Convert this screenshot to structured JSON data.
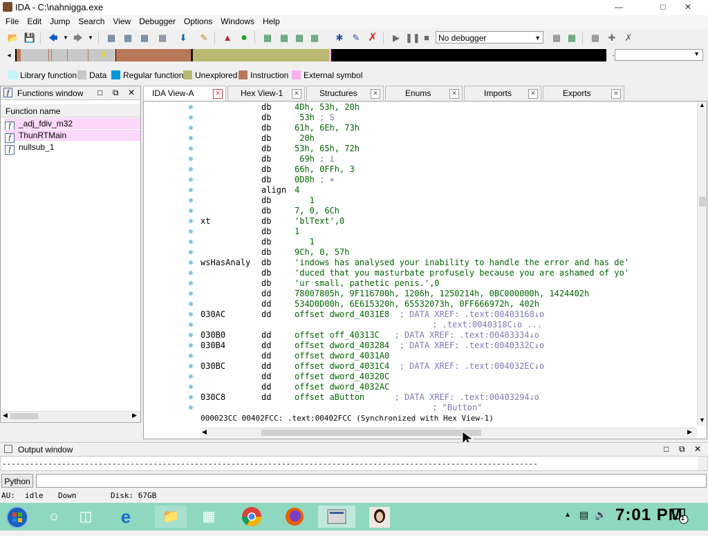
{
  "window": {
    "title": "IDA - C:\\nahnigga.exe"
  },
  "menu": [
    "File",
    "Edit",
    "Jump",
    "Search",
    "View",
    "Debugger",
    "Options",
    "Windows",
    "Help"
  ],
  "toolbar": {
    "debugger_select": "No debugger"
  },
  "legend": [
    {
      "label": "Library function",
      "color": "#c0f4f8"
    },
    {
      "label": "Data",
      "color": "#c8c8c8"
    },
    {
      "label": "Regular function",
      "color": "#0098d8"
    },
    {
      "label": "Unexplored",
      "color": "#b8b870"
    },
    {
      "label": "Instruction",
      "color": "#b87858"
    },
    {
      "label": "External symbol",
      "color": "#f8b0f0"
    }
  ],
  "functions_window": {
    "title": "Functions window",
    "column": "Function name",
    "items": [
      "_adj_fdiv_m32",
      "ThunRTMain",
      "nullsub_1"
    ]
  },
  "tabs": [
    "IDA View-A",
    "Hex View-1",
    "Structures",
    "Enums",
    "Imports",
    "Exports"
  ],
  "disasm": [
    {
      "label": "",
      "mn": "db",
      "ops": "4Dh, 53h, 20h",
      "cmt": ""
    },
    {
      "label": "",
      "mn": "db",
      "ops": " 53h",
      "cmt": "; S"
    },
    {
      "label": "",
      "mn": "db",
      "ops": "61h, 6Eh, 73h",
      "cmt": ""
    },
    {
      "label": "",
      "mn": "db",
      "ops": " 20h",
      "cmt": ""
    },
    {
      "label": "",
      "mn": "db",
      "ops": "53h, 65h, 72h",
      "cmt": ""
    },
    {
      "label": "",
      "mn": "db",
      "ops": " 69h",
      "cmt": "; i"
    },
    {
      "label": "",
      "mn": "db",
      "ops": "66h, 0FFh, 3",
      "cmt": ""
    },
    {
      "label": "",
      "mn": "db",
      "ops": "0D8h",
      "cmt": "; +"
    },
    {
      "label": "",
      "mn": "align",
      "ops": "4",
      "cmt": ""
    },
    {
      "label": "",
      "mn": "db",
      "ops": "   1",
      "cmt": ""
    },
    {
      "label": "",
      "mn": "db",
      "ops": "7, 0, 6Ch",
      "cmt": ""
    },
    {
      "label": "xt",
      "mn": "db",
      "ops": "'blText',0",
      "cmt": ""
    },
    {
      "label": "",
      "mn": "db",
      "ops": "1",
      "cmt": ""
    },
    {
      "label": "",
      "mn": "db",
      "ops": "   1",
      "cmt": ""
    },
    {
      "label": "",
      "mn": "db",
      "ops": "9Ch, 0, 57h",
      "cmt": ""
    },
    {
      "label": "wsHasAnaly",
      "mn": "db",
      "ops": "'indows has analysed your inability to handle the error and has de'",
      "cmt": ""
    },
    {
      "label": "",
      "mn": "db",
      "ops": "'duced that you masturbate profusely because you are ashamed of yo'",
      "cmt": ""
    },
    {
      "label": "",
      "mn": "db",
      "ops": "'ur small, pathetic penis.',0",
      "cmt": ""
    },
    {
      "label": "",
      "mn": "dd",
      "ops": "78007805h, 9F116700h, 1206h, 1250214h, 0BC000000h, 1424402h",
      "cmt": ""
    },
    {
      "label": "",
      "mn": "dd",
      "ops": "534D0D00h, 6E615320h, 65532073h, 0FF666972h, 402h",
      "cmt": ""
    },
    {
      "label": "030AC",
      "mn": "dd",
      "ops": "offset dword_4031E8 ",
      "cmt": "; DATA XREF: .text:00403168↓o"
    },
    {
      "label": "",
      "mn": "",
      "ops": "",
      "cmt": "; .text:0040318C↓o ..."
    },
    {
      "label": "030B0",
      "mn": "dd",
      "ops": "offset off_40313C  ",
      "cmt": "; DATA XREF: .text:00403334↓o"
    },
    {
      "label": "030B4",
      "mn": "dd",
      "ops": "offset dword_403284 ",
      "cmt": "; DATA XREF: .text:0040332C↓o"
    },
    {
      "label": "",
      "mn": "dd",
      "ops": "offset dword_4031A0",
      "cmt": ""
    },
    {
      "label": "030BC",
      "mn": "dd",
      "ops": "offset dword_4031C4 ",
      "cmt": "; DATA XREF: .text:004032EC↓o"
    },
    {
      "label": "",
      "mn": "dd",
      "ops": "offset dword_40320C",
      "cmt": ""
    },
    {
      "label": "",
      "mn": "dd",
      "ops": "offset dword_4032AC",
      "cmt": ""
    },
    {
      "label": "030C8",
      "mn": "dd",
      "ops": "offset aButton     ",
      "cmt": "; DATA XREF: .text:00403294↓o"
    },
    {
      "label": "",
      "mn": "",
      "ops": "",
      "cmt": "; \"Button\""
    }
  ],
  "disasm_status": "000023CC 00402FCC: .text:00402FCC (Synchronized with Hex View-1)",
  "output_window": {
    "title": "Output window",
    "text": "---------------------------------------------------------------------------------------------------------------------"
  },
  "python_button": "Python",
  "ida_status": {
    "au": "AU:",
    "state": "idle",
    "dir": "Down",
    "disk": "Disk: 67GB"
  },
  "taskbar": {
    "clock": "7:01 PM",
    "notification_count": "1"
  }
}
